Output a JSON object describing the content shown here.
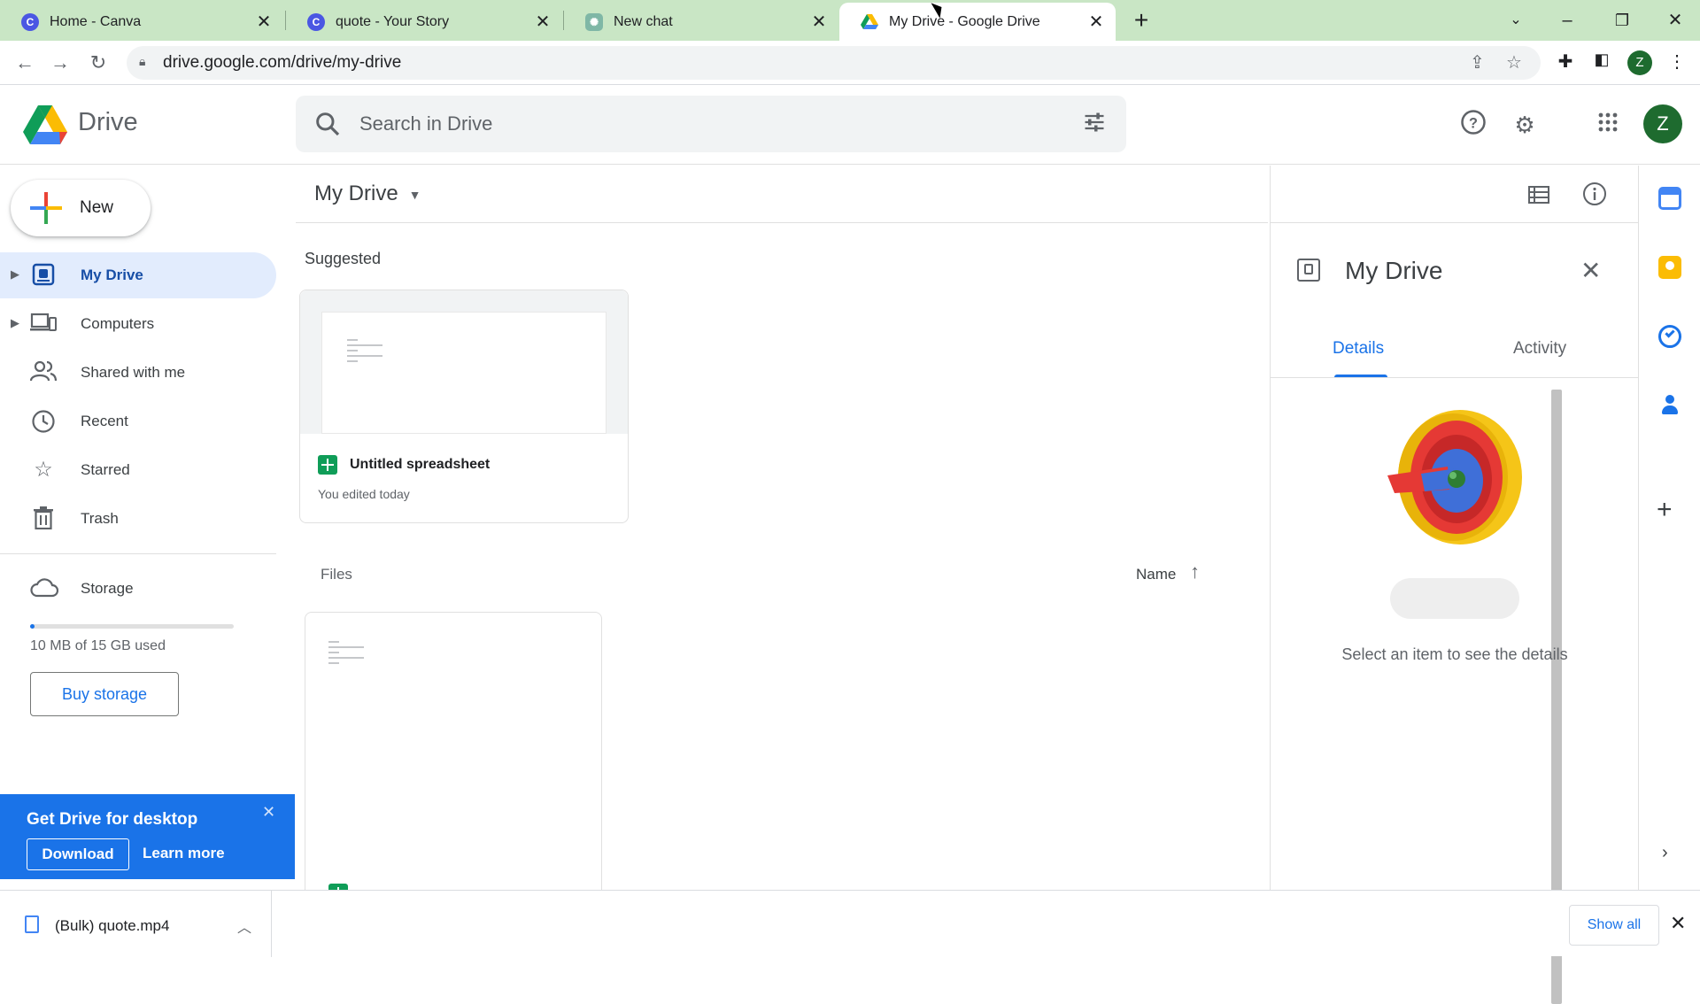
{
  "browser": {
    "tabs": [
      {
        "title": "Home - Canva",
        "icon": "canva-icon",
        "color": "#4a57e3"
      },
      {
        "title": "quote - Your Story",
        "icon": "canva-icon",
        "color": "#4a57e3"
      },
      {
        "title": "New chat",
        "icon": "chatgpt-icon",
        "color": "#7fb7a6"
      },
      {
        "title": "My Drive - Google Drive",
        "icon": "google-drive-icon",
        "color": "#1a73e8"
      }
    ],
    "url": "drive.google.com/drive/my-drive",
    "profile_initial": "Z"
  },
  "header": {
    "app_name": "Drive",
    "search_placeholder": "Search in Drive",
    "avatar_initial": "Z"
  },
  "sidebar": {
    "new_label": "New",
    "items": [
      {
        "label": "My Drive",
        "icon": "my-drive-icon",
        "selected": true,
        "expandable": true
      },
      {
        "label": "Computers",
        "icon": "computers-icon",
        "selected": false,
        "expandable": true
      },
      {
        "label": "Shared with me",
        "icon": "people-icon",
        "selected": false,
        "expandable": false
      },
      {
        "label": "Recent",
        "icon": "clock-icon",
        "selected": false,
        "expandable": false
      },
      {
        "label": "Starred",
        "icon": "star-icon",
        "selected": false,
        "expandable": false
      },
      {
        "label": "Trash",
        "icon": "trash-icon",
        "selected": false,
        "expandable": false
      }
    ],
    "storage_label": "Storage",
    "storage_used": "10 MB of 15 GB used",
    "storage_fraction": 0.01,
    "buy_storage": "Buy storage"
  },
  "promo": {
    "title": "Get Drive for desktop",
    "download": "Download",
    "learn_more": "Learn more"
  },
  "main": {
    "title": "My Drive",
    "suggested_label": "Suggested",
    "suggested": [
      {
        "name": "Untitled spreadsheet",
        "subtitle": "You edited today"
      }
    ],
    "files_label": "Files",
    "sort_label": "Name"
  },
  "details": {
    "title": "My Drive",
    "tabs": [
      "Details",
      "Activity"
    ],
    "active_tab": "Details",
    "empty_message": "Select an item to see the details"
  },
  "downloads": {
    "file": "(Bulk) quote.mp4",
    "show_all": "Show all"
  },
  "colors": {
    "accent": "#1a73e8",
    "tabbar": "#c9e6c5",
    "selected_nav": "#e2ecfd",
    "sheets_green": "#0f9d58",
    "avatar": "#1e6b2f"
  }
}
